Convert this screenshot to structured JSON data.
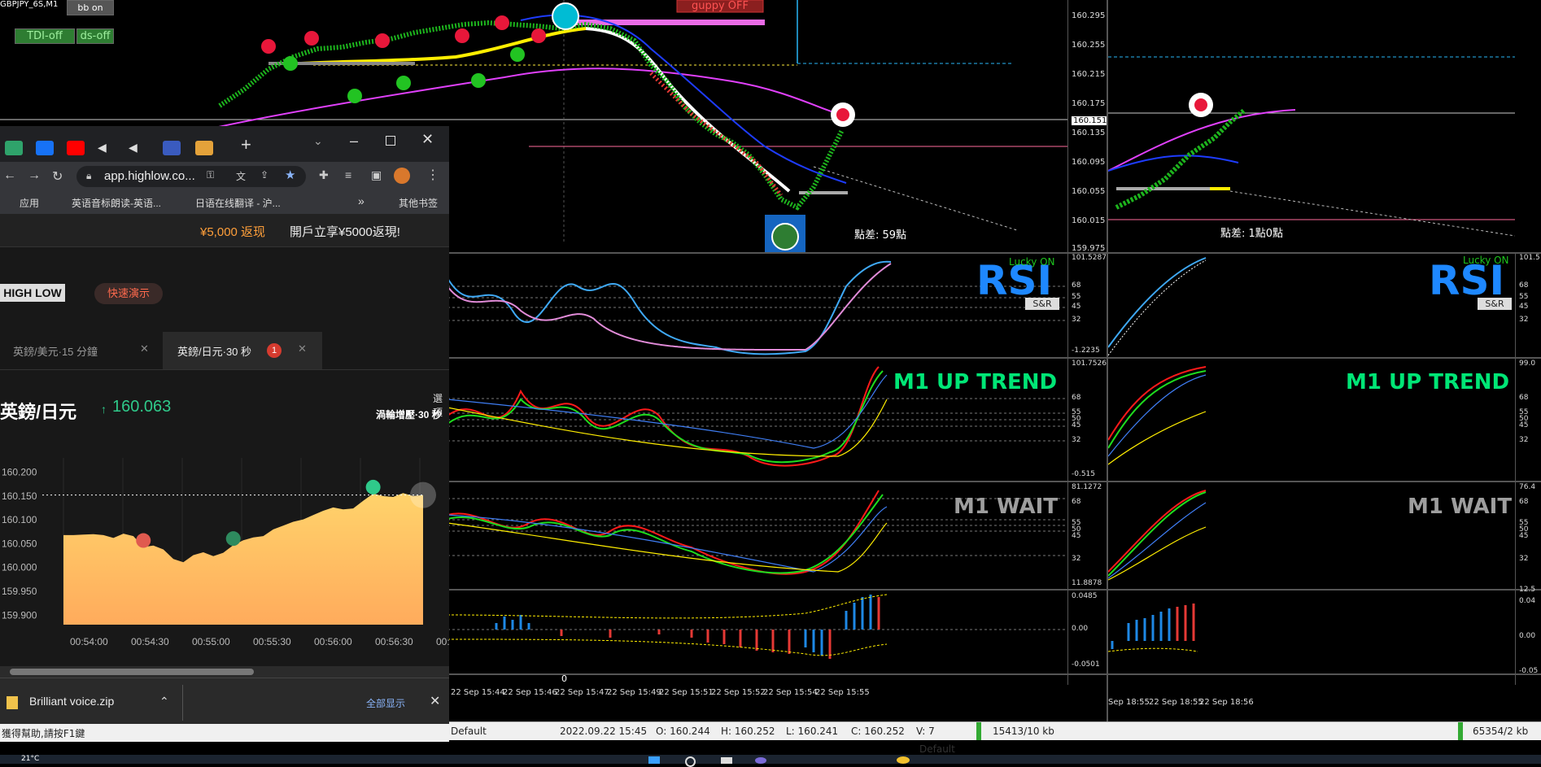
{
  "mt4": {
    "symbol_label": "GBPJPY_6S,M1",
    "buttons": {
      "bb": "bb on",
      "tdi": "TDI-off",
      "ds": "ds-off",
      "guppy": "guppy OFF"
    },
    "price_ticks_left": [
      "160.295",
      "160.255",
      "160.215",
      "160.175",
      "160.135",
      "160.095",
      "160.055",
      "160.015",
      "159.975"
    ],
    "current_price": "160.151",
    "spread_left": "點差: 59點",
    "spread_right": "點差: 1點0點",
    "rsi_label": "RSI",
    "lucky_on": "Lucky ON",
    "sr_label": "S&R",
    "rsi_ticks": [
      "101.5287",
      "68",
      "55",
      "45",
      "32",
      "-1.2235"
    ],
    "tdi_ticks": [
      "101.7526",
      "68",
      "55",
      "50",
      "45",
      "32",
      "-0.515"
    ],
    "wait_ticks": [
      "81.1272",
      "68",
      "55",
      "50",
      "45",
      "32",
      "11.8878"
    ],
    "macd_ticks": [
      "0.0485",
      "0.00",
      "-0.0501"
    ],
    "right_rsi_ticks": [
      "101.5",
      "68",
      "55",
      "45",
      "32"
    ],
    "right_tdi_ticks": [
      "99.0",
      "68",
      "55",
      "50",
      "45",
      "32"
    ],
    "right_wait_ticks": [
      "76.4",
      "68",
      "55",
      "50",
      "45",
      "32",
      "12.5"
    ],
    "right_macd_ticks": [
      "0.04",
      "0.00",
      "-0.05"
    ],
    "trend_up": "M1 UP TREND",
    "trend_wait": "M1 WAIT",
    "zero_label": "0",
    "time_ticks_left": [
      "22 Sep 15:44",
      "22 Sep 15:46",
      "22 Sep 15:47",
      "22 Sep 15:49",
      "22 Sep 15:51",
      "22 Sep 15:52",
      "22 Sep 15:54",
      "22 Sep 15:55"
    ],
    "time_ticks_right": [
      "Sep 18:55",
      "22 Sep 18:55",
      "22 Sep 18:56"
    ],
    "status": {
      "profile": "Default",
      "datetime": "2022.09.22 15:45",
      "open": "O: 160.244",
      "high": "H: 160.252",
      "low": "L: 160.241",
      "close": "C: 160.252",
      "volume": "V: 7",
      "bars": "15413/10 kb",
      "profile2": "Default",
      "bars2": "65354/2 kb"
    }
  },
  "browser": {
    "url": "app.highlow.co...",
    "bookmarks": [
      "应用",
      "英语音标朗读-英语...",
      "日语在线翻译 - 沪...",
      "»",
      "其他书签"
    ],
    "promo_amount": "¥5,000 返现",
    "promo_text": "開戶立享¥5000返現!",
    "logo": "HIGH LOW",
    "demo_button": "快速演示",
    "tabs": [
      {
        "label": "英鎊/美元·15 分鐘"
      },
      {
        "label": "英鎊/日元·30 秒",
        "badge": "1"
      }
    ],
    "pair": "英鎊/日元",
    "price": "160.063",
    "option_label": "選項",
    "turbo_label": "渦輪增壓·30 秒",
    "chart_data": {
      "type": "area",
      "x_ticks": [
        "00:54:00",
        "00:54:30",
        "00:55:00",
        "00:55:30",
        "00:56:00",
        "00:56:30",
        "00:"
      ],
      "y_ticks": [
        "160.200",
        "160.150",
        "160.100",
        "160.050",
        "160.000",
        "159.950",
        "159.900"
      ],
      "ylim": [
        159.88,
        160.23
      ],
      "values": [
        160.068,
        160.068,
        160.069,
        160.07,
        160.068,
        160.062,
        160.071,
        160.066,
        160.043,
        160.046,
        160.038,
        160.018,
        160.011,
        160.026,
        160.032,
        160.024,
        160.031,
        160.047,
        160.057,
        160.063,
        160.066,
        160.08,
        160.088,
        160.096,
        160.101,
        160.11,
        160.119,
        160.126,
        160.122,
        160.124,
        160.14,
        160.155,
        160.15,
        160.148,
        160.156,
        160.15,
        160.152
      ]
    }
  },
  "download": {
    "filename": "Brilliant voice.zip",
    "show_all": "全部显示"
  },
  "help_text": "獲得幫助,請按F1鍵",
  "taskbar": {
    "temp": "21°C"
  },
  "colors": {
    "accent_green": "#00e676",
    "wait_gray": "#9e9e9e",
    "highlow_orange": "#ffb74d"
  }
}
